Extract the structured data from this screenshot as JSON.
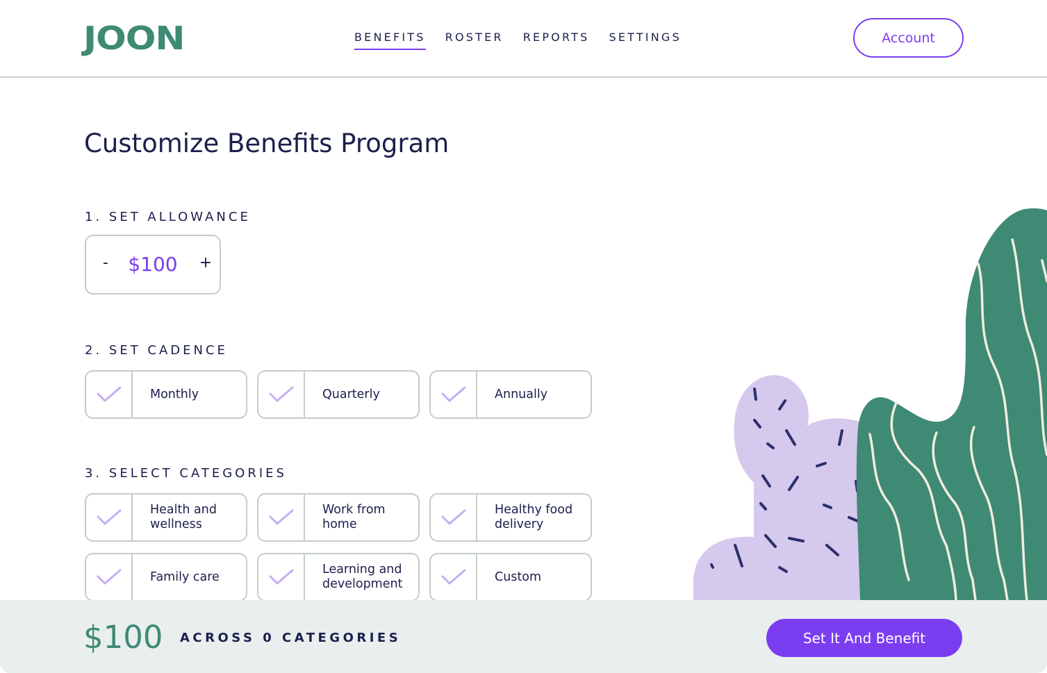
{
  "header": {
    "logo": "JOON",
    "nav": [
      {
        "label": "BENEFITS",
        "active": true
      },
      {
        "label": "ROSTER",
        "active": false
      },
      {
        "label": "REPORTS",
        "active": false
      },
      {
        "label": "SETTINGS",
        "active": false
      }
    ],
    "account_label": "Account"
  },
  "main": {
    "title": "Customize Benefits Program",
    "allowance": {
      "label": "1. SET ALLOWANCE",
      "minus": "-",
      "value": "$100",
      "plus": "+"
    },
    "cadence": {
      "label": "2. SET CADENCE",
      "options": [
        {
          "label": "Monthly",
          "check_icon": "check-icon"
        },
        {
          "label": "Quarterly",
          "check_icon": "check-icon"
        },
        {
          "label": "Annually",
          "check_icon": "check-icon"
        }
      ]
    },
    "categories": {
      "label": "3. SELECT CATEGORIES",
      "options": [
        {
          "label": "Health and wellness"
        },
        {
          "label": "Work from home"
        },
        {
          "label": "Healthy food delivery"
        },
        {
          "label": "Family care"
        },
        {
          "label": "Learning and development"
        },
        {
          "label": "Custom"
        }
      ]
    }
  },
  "footer": {
    "total": "$100",
    "summary": "ACROSS 0 CATEGORIES",
    "cta_label": "Set It And Benefit"
  },
  "colors": {
    "brand_green": "#3e8a74",
    "accent_purple": "#7b3df0",
    "check_lavender": "#c3aef0",
    "navy_text": "#1b1f4b",
    "footer_bg": "#e9efee",
    "cactus_lavender": "#d5c9ed"
  }
}
